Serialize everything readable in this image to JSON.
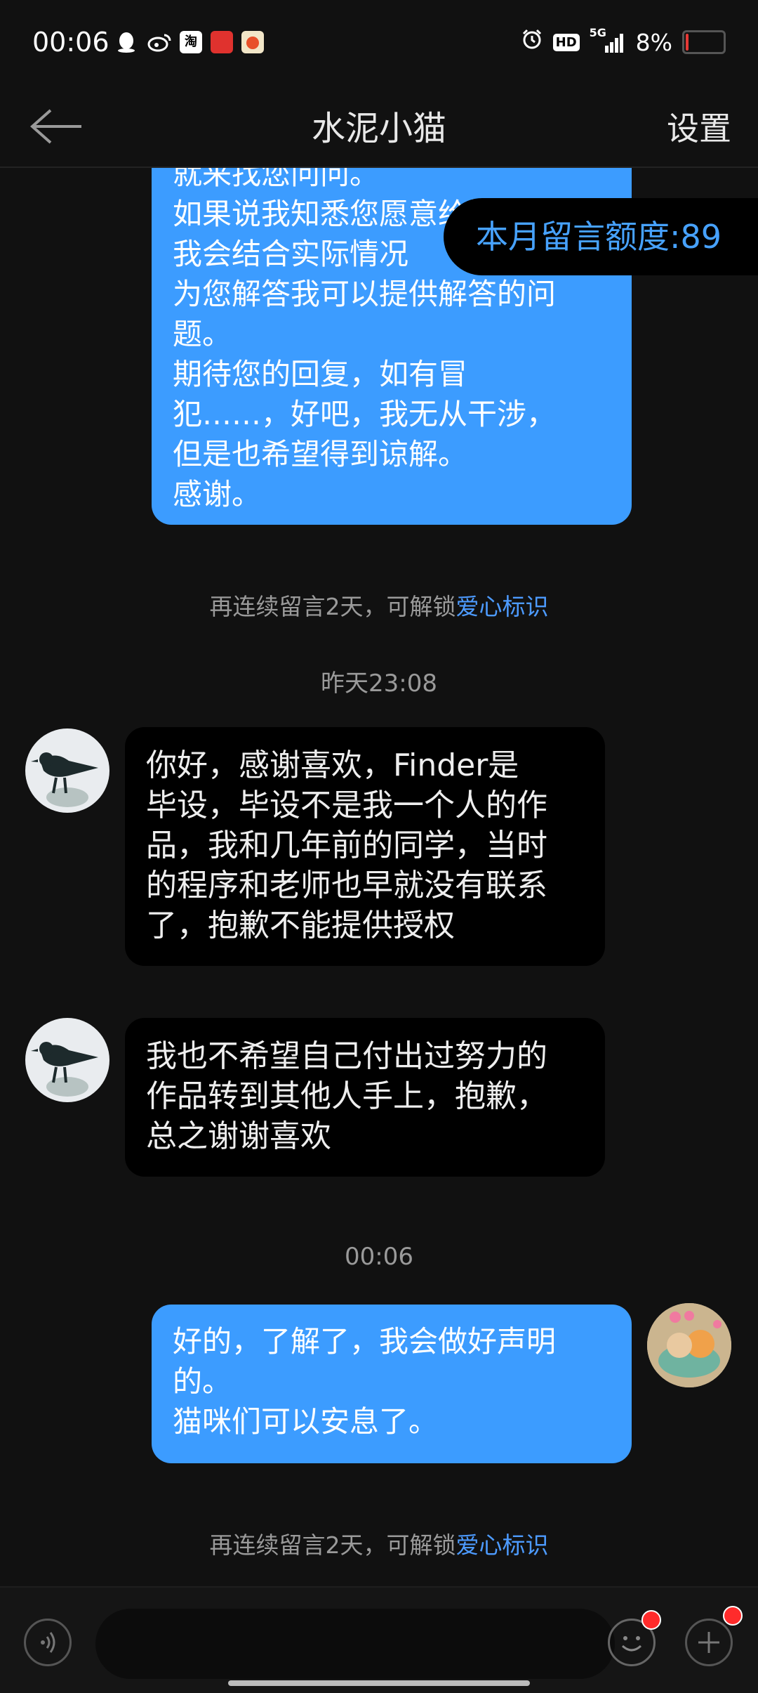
{
  "status_bar": {
    "time": "00:06",
    "battery": "8%",
    "network": "5G",
    "hd": "HD"
  },
  "header": {
    "title": "水泥小猫",
    "settings": "设置"
  },
  "quota": {
    "text": "本月留言额度:89"
  },
  "messages": {
    "out1": {
      "lines": [
        "我会结合实际情况",
        "为您解答我可以提供解答的问",
        "题。",
        "期待您的回复，如有冒",
        "犯……，好吧，我无从干涉，",
        "但是也希望得到谅解。",
        "感谢。"
      ],
      "partial_top_1": "就来找您问问。",
      "partial_top_2": "如果说我知悉您愿意给授权，"
    },
    "sys1": {
      "prefix": "再连续留言2天，可解锁",
      "link": "爱心标识"
    },
    "ts1": "昨天23:08",
    "in1": {
      "lines": [
        "你好，感谢喜欢，Finder是",
        "毕设，毕设不是我一个人的作",
        "品，我和几年前的同学，当时",
        "的程序和老师也早就没有联系",
        "了，抱歉不能提供授权"
      ]
    },
    "in2": {
      "lines": [
        "我也不希望自己付出过努力的",
        "作品转到其他人手上，抱歉，",
        "总之谢谢喜欢"
      ]
    },
    "ts2": "00:06",
    "out2": {
      "lines": [
        "好的，了解了，我会做好声明",
        "的。",
        "猫咪们可以安息了。"
      ]
    },
    "sys2": {
      "prefix": "再连续留言2天，可解锁",
      "link": "爱心标识"
    }
  },
  "colors": {
    "accent": "#3c9cff",
    "link": "#4d9bff",
    "badge": "#ff2b2b"
  },
  "icons": [
    "back-arrow-icon",
    "voice-icon",
    "emoji-icon",
    "plus-icon",
    "alarm-icon",
    "signal-icon",
    "battery-icon"
  ]
}
